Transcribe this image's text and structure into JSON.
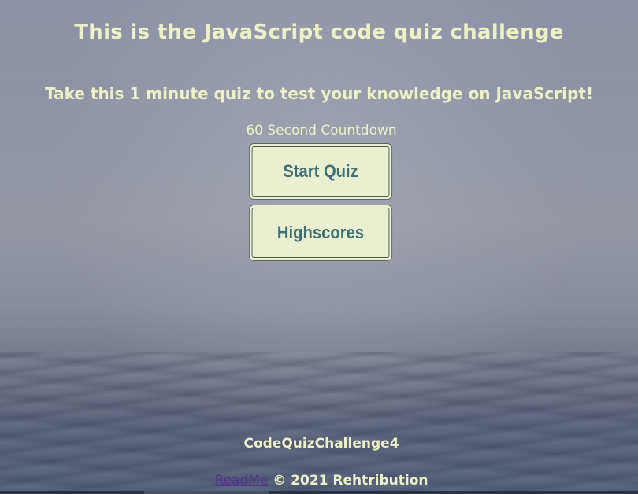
{
  "header": {
    "title": "This is the JavaScript code quiz challenge",
    "subtitle": "Take this 1 minute quiz to test your knowledge on JavaScript!",
    "countdown": "60 Second Countdown"
  },
  "buttons": {
    "start_label": "Start Quiz",
    "highscores_label": "Highscores"
  },
  "footer": {
    "project_name": "CodeQuizChallenge4",
    "readme_link": "ReadMe",
    "copyright": "© 2021 Rehtribution"
  },
  "colors": {
    "text": "#eef0c8",
    "button_bg": "#eaf0cf",
    "button_text": "#3e6f76",
    "link": "#55338f"
  }
}
